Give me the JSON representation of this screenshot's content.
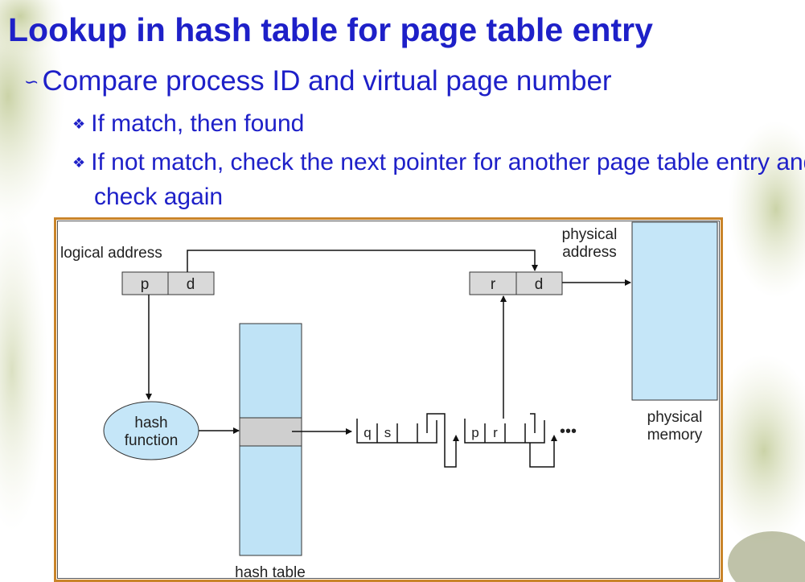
{
  "slide": {
    "title": "Lookup in hash table for page table entry",
    "bullets": [
      {
        "text": "Compare process ID and virtual page number",
        "icon": "swirl-bullet-icon",
        "children": [
          {
            "text": "If match, then found",
            "icon": "diamond-bullet-icon"
          },
          {
            "text": "If not match, check the next pointer for another page table entry and check again",
            "icon": "diamond-bullet-icon"
          }
        ]
      }
    ]
  },
  "diagram": {
    "logical_address_label": "logical address",
    "logical_fields": [
      "p",
      "d"
    ],
    "physical_address_label": [
      "physical",
      "address"
    ],
    "physical_fields": [
      "r",
      "d"
    ],
    "hash_function_label": [
      "hash",
      "function"
    ],
    "hash_table_label": "hash table",
    "chain": [
      {
        "fields": [
          "q",
          "s"
        ]
      },
      {
        "fields": [
          "p",
          "r"
        ]
      }
    ],
    "ellipsis": "•••",
    "physical_memory_label": [
      "physical",
      "memory"
    ],
    "colors": {
      "text": "#1e20c8",
      "memory_fill": "#c5e6f8",
      "hash_fill": "#bfe3f6",
      "field_fill": "#d9d9d9",
      "frame": "#c9842a"
    }
  }
}
